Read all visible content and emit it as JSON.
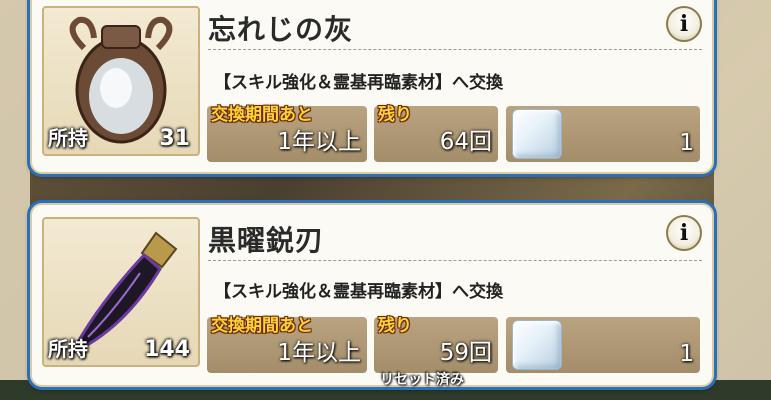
{
  "items": [
    {
      "name": "忘れじの灰",
      "icon": "ash-urn-icon",
      "owned_label": "所持",
      "owned_count": "31",
      "description": "【スキル強化＆霊基再臨素材】へ交換",
      "period_label": "交換期間あと",
      "period_value": "1年以上",
      "remaining_label": "残り",
      "remaining_value": "64回",
      "reward_icon": "crystal-cube-icon",
      "reward_count": "1"
    },
    {
      "name": "黒曜鋭刃",
      "icon": "obsidian-blade-icon",
      "owned_label": "所持",
      "owned_count": "144",
      "description": "【スキル強化＆霊基再臨素材】へ交換",
      "period_label": "交換期間あと",
      "period_value": "1年以上",
      "remaining_label": "残り",
      "remaining_value": "59回",
      "reward_icon": "crystal-cube-icon",
      "reward_count": "1"
    }
  ],
  "reset_note": "リセット済み",
  "info_glyph": "i",
  "colors": {
    "card_border": "#2a6fb8",
    "label_gold": "#ffd23a",
    "cell_bg": "#a48d6a"
  }
}
